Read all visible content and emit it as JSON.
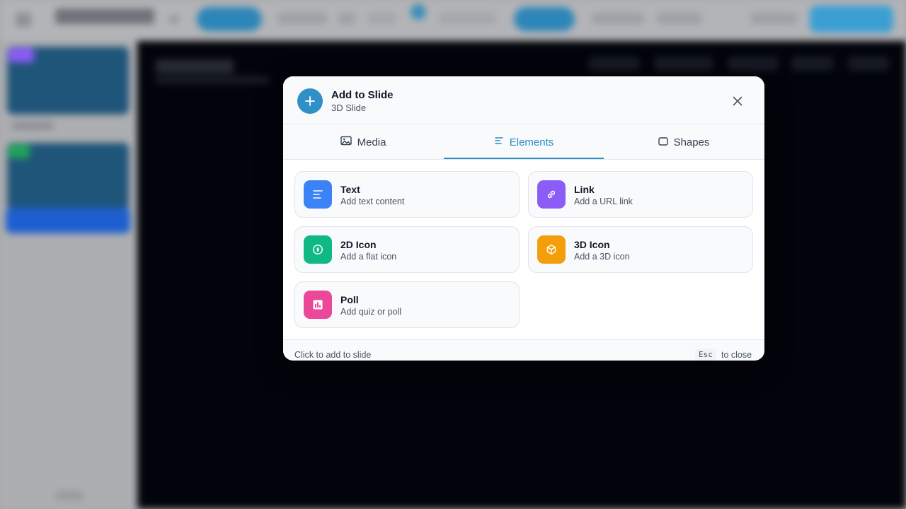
{
  "modal": {
    "title": "Add to Slide",
    "subtitle": "3D Slide",
    "header_icon": "plus-icon",
    "close_icon": "close-icon",
    "tabs": [
      {
        "label": "Media",
        "icon": "image-icon",
        "active": false
      },
      {
        "label": "Elements",
        "icon": "text-lines-icon",
        "active": true
      },
      {
        "label": "Shapes",
        "icon": "rectangle-icon",
        "active": false
      }
    ],
    "cards": [
      {
        "title": "Text",
        "desc": "Add text content",
        "icon": "text-icon",
        "color": "#3b82f6"
      },
      {
        "title": "Link",
        "desc": "Add a URL link",
        "icon": "link-icon",
        "color": "#8b5cf6"
      },
      {
        "title": "2D Icon",
        "desc": "Add a flat icon",
        "icon": "compass-icon",
        "color": "#10b981"
      },
      {
        "title": "3D Icon",
        "desc": "Add a 3D icon",
        "icon": "cube-icon",
        "color": "#f59e0b"
      },
      {
        "title": "Poll",
        "desc": "Add quiz or poll",
        "icon": "bar-chart-icon",
        "color": "#ec4899"
      }
    ],
    "footer": {
      "hint": "Click to add to slide",
      "key": "Esc",
      "key_suffix": "to close"
    }
  },
  "colors": {
    "accent": "#2b8cc4",
    "canvas_bg": "#02040b"
  }
}
